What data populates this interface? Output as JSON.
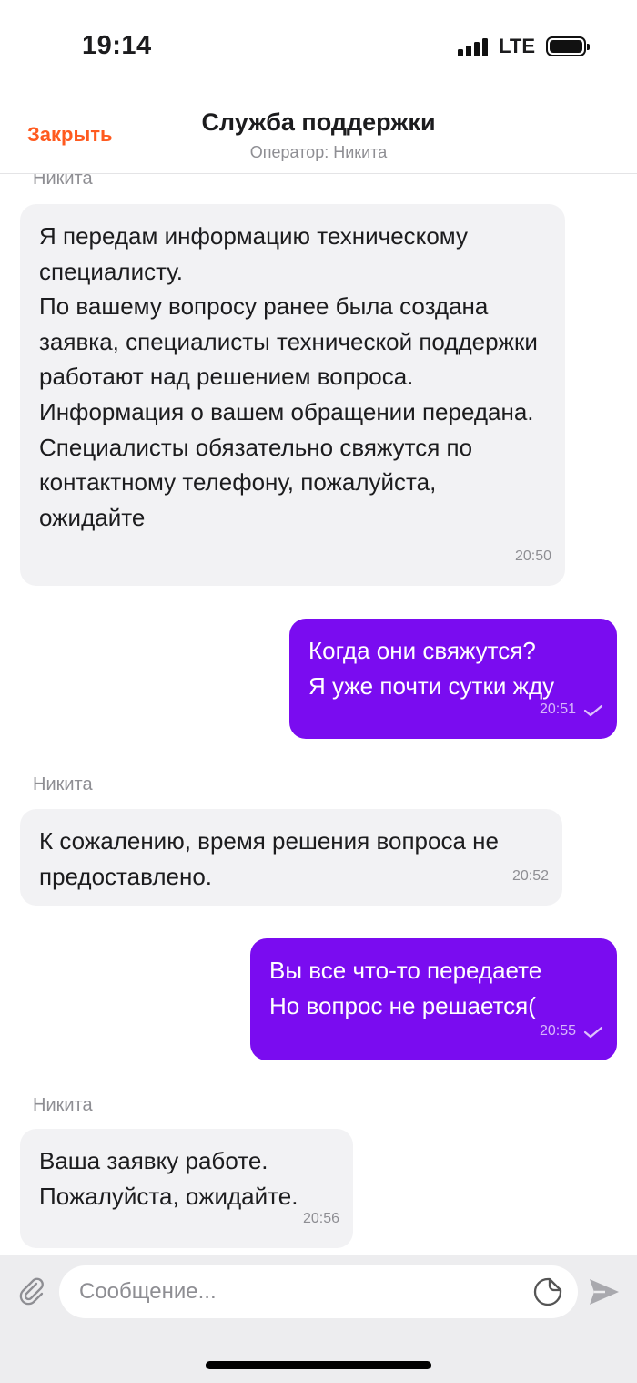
{
  "status_bar": {
    "time": "19:14",
    "network": "LTE"
  },
  "header": {
    "close_label": "Закрыть",
    "title": "Служба поддержки",
    "subtitle": "Оператор: Никита"
  },
  "messages": [
    {
      "direction": "in",
      "sender": "Никита",
      "text": "Я передам информацию техническому специалисту.\nПо вашему вопросу ранее была создана заявка, специалисты технической поддержки работают над решением вопроса. Информация о вашем обращении передана. Специалисты обязательно свяжутся по контактному телефону, пожалуйста, ожидайте",
      "time": "20:50"
    },
    {
      "direction": "out",
      "text": "Когда они свяжутся?\nЯ уже почти сутки жду",
      "time": "20:51",
      "status_icon": "check-icon"
    },
    {
      "direction": "in",
      "sender": "Никита",
      "text": "К сожалению, время решения вопроса не предоставлено.",
      "time": "20:52"
    },
    {
      "direction": "out",
      "text": "Вы все что-то передаете\nНо вопрос не решается(",
      "time": "20:55",
      "status_icon": "check-icon"
    },
    {
      "direction": "in",
      "sender": "Никита",
      "text": "Ваша заявку работе.\nПожалуйста, ожидайте.",
      "time": "20:56"
    }
  ],
  "composer": {
    "placeholder": "Сообщение...",
    "attach_icon": "paperclip-icon",
    "sticker_icon": "sticker-icon",
    "send_icon": "send-icon"
  },
  "colors": {
    "accent": "#ff5a1f",
    "outgoing_bubble": "#7a0cf0",
    "incoming_bubble": "#f2f2f4",
    "secondary_text": "#8e8e93",
    "composer_bg": "#ededef"
  }
}
